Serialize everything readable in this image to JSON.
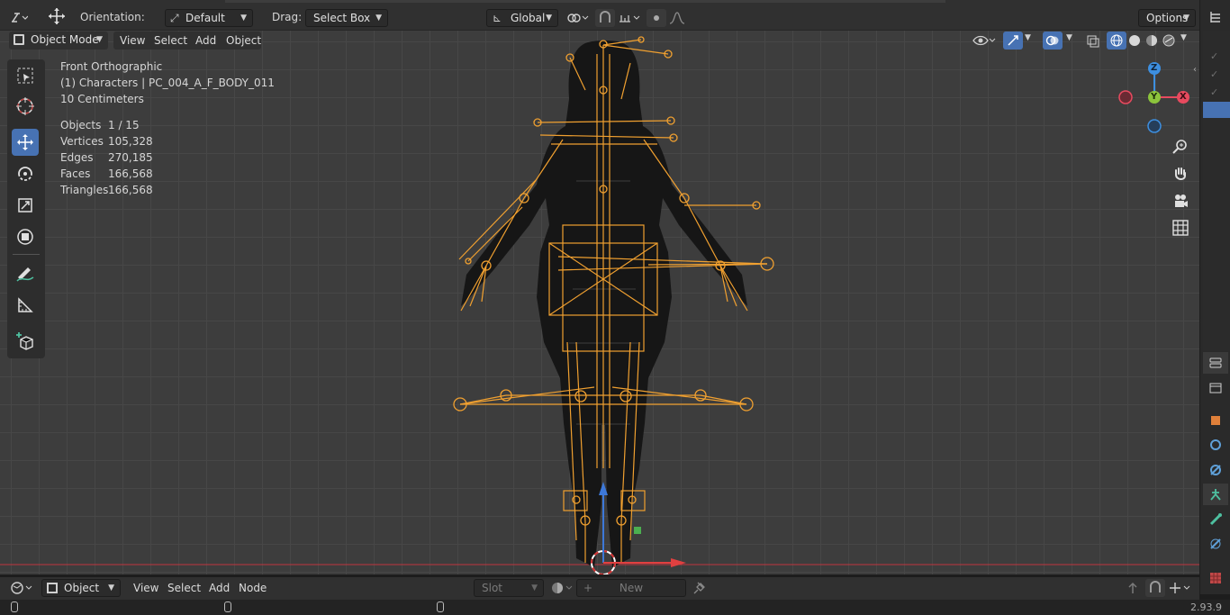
{
  "header": {
    "orientation_label": "Orientation:",
    "orientation_value": "Default",
    "drag_label": "Drag:",
    "drag_value": "Select Box",
    "transform_space": "Global",
    "options_label": "Options"
  },
  "viewport_header": {
    "mode": "Object Mode",
    "menus": [
      "View",
      "Select",
      "Add",
      "Object"
    ]
  },
  "overlay": {
    "view_name": "Front Orthographic",
    "collection_line": "(1) Characters | PC_004_A_F_BODY_011",
    "scale": "10 Centimeters",
    "stats": [
      {
        "label": "Objects",
        "value": "1 / 15"
      },
      {
        "label": "Vertices",
        "value": "105,328"
      },
      {
        "label": "Edges",
        "value": "270,185"
      },
      {
        "label": "Faces",
        "value": "166,568"
      },
      {
        "label": "Triangles",
        "value": "166,568"
      }
    ]
  },
  "gizmo": {
    "z": "Z",
    "y": "Y",
    "x": "X"
  },
  "node_editor": {
    "type": "Object",
    "menus": [
      "View",
      "Select",
      "Add",
      "Node"
    ],
    "slot": "Slot",
    "new_label": "New"
  },
  "status": {
    "version": "2.93.9"
  },
  "colors": {
    "active_blue": "#4772b3",
    "armature_orange": "#f0a030",
    "axis_x": "#e84a5f",
    "axis_y": "#8cc43c",
    "axis_z": "#3d8fe0"
  }
}
